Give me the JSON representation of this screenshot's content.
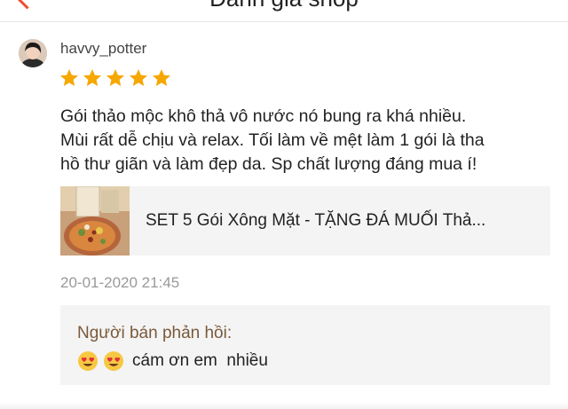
{
  "header": {
    "title": "Đánh giá shop"
  },
  "review": {
    "username": "havvy_potter",
    "rating": 5,
    "text": "Gói thảo mộc khô thả vô nước nó bung ra khá nhiều.\nMùi rất dễ chịu và relax. Tối làm về mệt làm 1 gói là tha\nhồ thư giãn và làm đẹp da. Sp chất lượng đáng mua í!",
    "product_name": "SET 5 Gói Xông Mặt - TẶNG ĐÁ MUỐI Thả...",
    "date": "20-01-2020 21:45",
    "seller_reply_label": "Người bán phản hồi:",
    "seller_reply_text": "cám ơn em  nhiều",
    "reply_emojis": [
      "heart-eyes-emoji",
      "heart-eyes-emoji"
    ]
  },
  "colors": {
    "accent": "#ee4d2d",
    "star": "#f6a700",
    "panel": "#f4f4f4",
    "reply_label": "#7a5a3a"
  }
}
